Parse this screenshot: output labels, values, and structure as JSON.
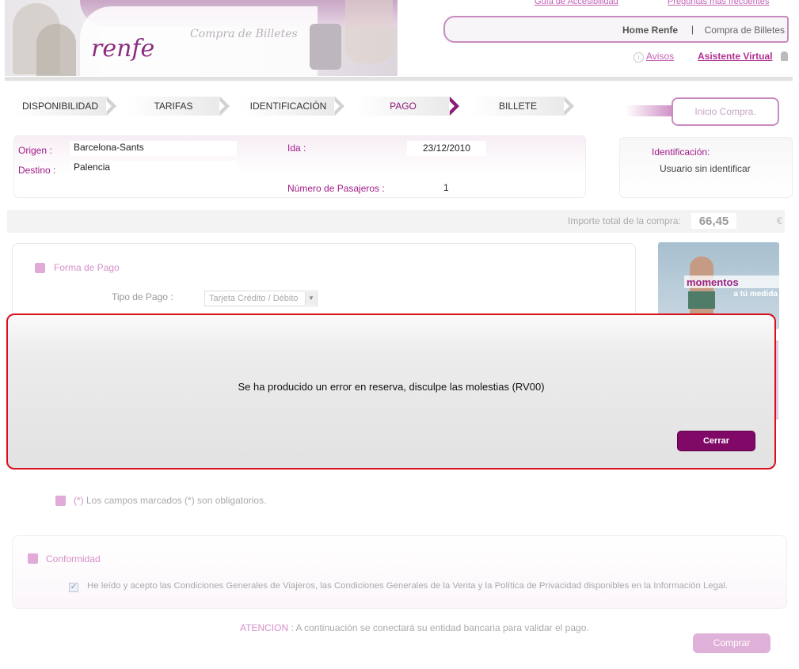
{
  "header": {
    "logo_text": "renfe",
    "banner_title": "Compra de Billetes",
    "top_links": [
      "Guía de Accesibilidad",
      "Preguntas más frecuentes"
    ],
    "toolbar": {
      "home": "Home Renfe",
      "separator": "|",
      "compra": "Compra de Billetes"
    },
    "avisos": "Avisos",
    "asistente": "Asistente Virtual"
  },
  "steps": [
    {
      "label": "DISPONIBILIDAD",
      "active": false
    },
    {
      "label": "TARIFAS",
      "active": false
    },
    {
      "label": "IDENTIFICACIÓN",
      "active": false
    },
    {
      "label": "PAGO",
      "active": true
    },
    {
      "label": "BILLETE",
      "active": false
    }
  ],
  "inicio_compra": "Inicio Compra.",
  "trip": {
    "origen_label": "Origen :",
    "origen": "Barcelona-Sants",
    "destino_label": "Destino :",
    "destino": "Palencia",
    "ida_label": "Ida :",
    "ida": "23/12/2010",
    "pasajeros_label": "Número de Pasajeros :",
    "pasajeros": "1"
  },
  "identificacion": {
    "label": "Identificación:",
    "value": "Usuario sin identificar"
  },
  "importe": {
    "label": "Importe total de la compra:",
    "value": "66,45",
    "currency": "€"
  },
  "forma_pago": {
    "title": "Forma de Pago",
    "tipo_label": "Tipo de Pago :",
    "tipo_value": "Tarjeta Crédito / Débito"
  },
  "promo": {
    "title": "momentos",
    "subtitle": "a tú medida"
  },
  "modal": {
    "message": "Se ha producido un error en reserva, disculpe las molestias (RV00)",
    "close_label": "Cerrar"
  },
  "obligatorios": {
    "asterisk": "(*)",
    "text": " Los campos marcados (*) son obligatorios."
  },
  "conformidad": {
    "title": "Conformidad",
    "accept_text": "He leído y acepto las Condiciones Generales de Viajeros, las Condiciones Generales de la Venta y la Política de Privacidad disponibles en la Información Legal.",
    "checked": true
  },
  "atencion": {
    "label": "ATENCION :",
    "text": " A continuación se conectará su entidad bancaria para validar el pago."
  },
  "comprar_label": "Comprar",
  "colors": {
    "accent": "#8a1a78",
    "error_border": "#d80f1a",
    "pink": "#e1aad8"
  }
}
